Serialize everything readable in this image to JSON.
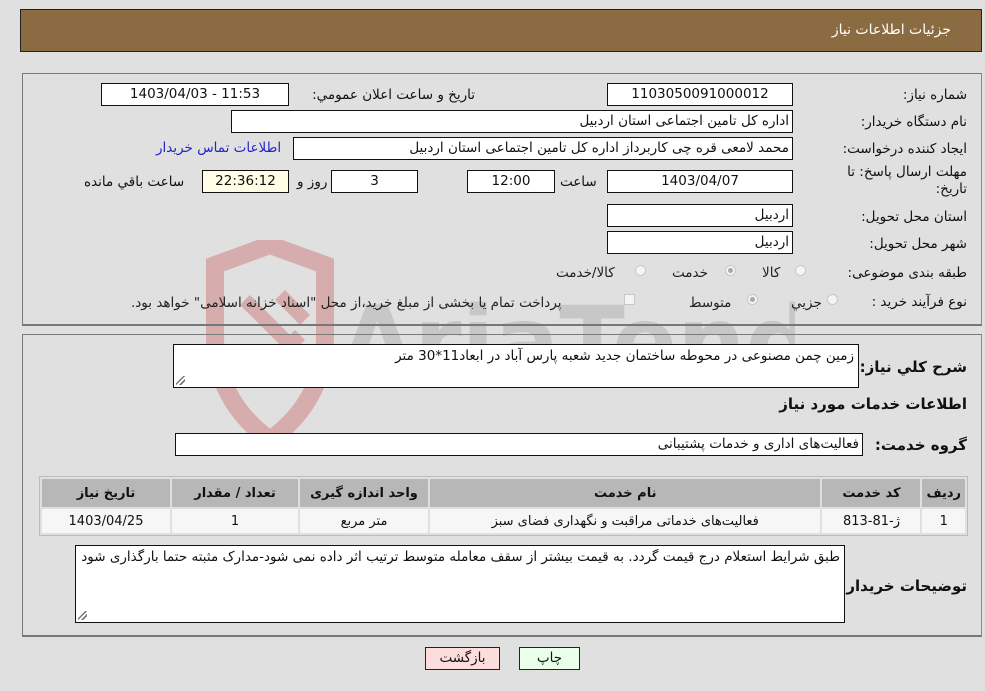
{
  "header": {
    "title": "جزئیات اطلاعات نیاز"
  },
  "details": {
    "need_number": {
      "label": "شماره نیاز:",
      "value": "1103050091000012"
    },
    "announce_datetime": {
      "label": "تاریخ و ساعت اعلان عمومي:",
      "value": "1403/04/03 - 11:53"
    },
    "buyer_org": {
      "label": "نام دستگاه خریدار:",
      "value": "اداره کل تامین اجتماعی استان اردبیل"
    },
    "requester": {
      "label": "ایجاد کننده درخواست:",
      "value": "محمد لامعی قره چی کاربرداز اداره کل تامین اجتماعی استان اردبیل"
    },
    "buyer_contact_link": "اطلاعات تماس خریدار",
    "deadline": {
      "label": "مهلت ارسال پاسخ: تا تاریخ:",
      "date": "1403/04/07",
      "time_label": "ساعت",
      "time": "12:00",
      "days": "3",
      "days_label": "روز و",
      "remaining": "22:36:12",
      "remaining_label": "ساعت باقي مانده"
    },
    "delivery_province": {
      "label": "استان محل تحویل:",
      "value": "اردبیل"
    },
    "delivery_city": {
      "label": "شهر محل تحویل:",
      "value": "اردبیل"
    },
    "category": {
      "label": "طبقه بندی موضوعی:",
      "options": [
        "کالا",
        "خدمت",
        "کالا/خدمت"
      ],
      "selected": "خدمت"
    },
    "purchase_process": {
      "label": "نوع فرآیند خرید :",
      "options": [
        "جزيي",
        "متوسط"
      ],
      "selected": "متوسط",
      "checkbox_label": "پرداخت تمام یا بخشی از مبلغ خرید،از محل \"اسناد خزانه اسلامی\" خواهد بود.",
      "checkbox_checked": false
    }
  },
  "description": {
    "label": "شرح کلي نیاز:",
    "value": "زمین چمن مصنوعی در محوطه ساختمان جدید شعبه پارس آباد در ابعاد11*30 متر"
  },
  "services_section": {
    "title": "اطلاعات خدمات مورد نیاز",
    "group_label": "گروه خدمت:",
    "group_value": "فعالیت‌های اداری و خدمات پشتیبانی"
  },
  "table": {
    "headers": [
      "ردیف",
      "کد خدمت",
      "نام خدمت",
      "واحد اندازه گیری",
      "تعداد / مقدار",
      "تاریخ نیاز"
    ],
    "rows": [
      [
        "1",
        "ژ-81-813",
        "فعالیت‌های خدماتی مراقبت و نگهداری فضای سبز",
        "متر مربع",
        "1",
        "1403/04/25"
      ]
    ]
  },
  "buyer_notes": {
    "label": "توضیحات خریدار:",
    "value": "طبق شرایط استعلام درج قیمت گردد. به قیمت بیشتر از سقف معامله متوسط ترتیب اثر داده نمی شود-مدارک مثبته حتما بارگذاری شود"
  },
  "buttons": {
    "print": "چاپ",
    "back": "بازگشت"
  },
  "watermark": {
    "text": "AriaTender.neT"
  }
}
